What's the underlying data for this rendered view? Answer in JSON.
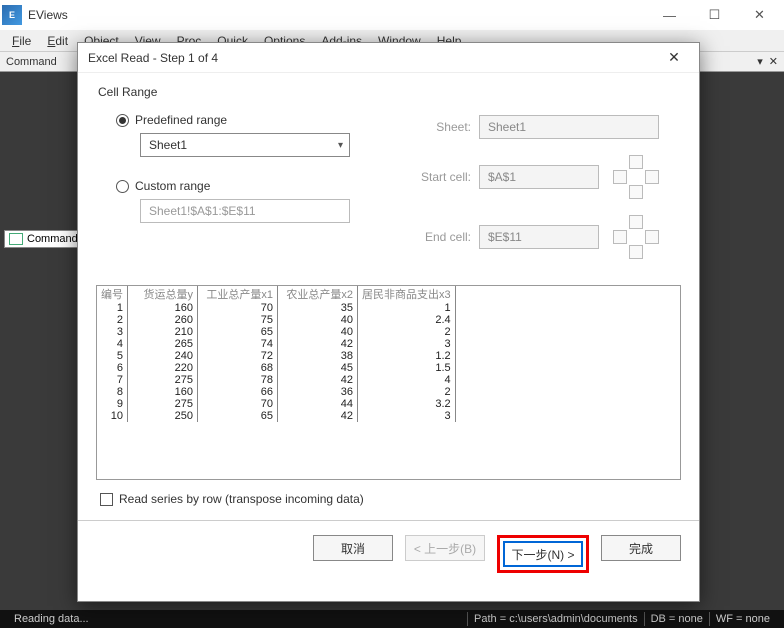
{
  "app": {
    "title": "EViews"
  },
  "menu": [
    "File",
    "Edit",
    "Object",
    "View",
    "Proc",
    "Quick",
    "Options",
    "Add-ins",
    "Window",
    "Help"
  ],
  "command_bar": {
    "label": "Command"
  },
  "command_panel": {
    "label": "Command"
  },
  "statusbar": {
    "left": "Reading data...",
    "path": "Path = c:\\users\\admin\\documents",
    "db": "DB = none",
    "wf": "WF = none"
  },
  "dialog": {
    "title": "Excel Read - Step 1 of 4",
    "group": "Cell Range",
    "predefined_label": "Predefined range",
    "predefined_value": "Sheet1",
    "custom_label": "Custom range",
    "custom_value": "Sheet1!$A$1:$E$11",
    "sheet_label": "Sheet:",
    "sheet_value": "Sheet1",
    "start_label": "Start cell:",
    "start_value": "$A$1",
    "end_label": "End cell:",
    "end_value": "$E$11",
    "checkbox_label": "Read series by row (transpose incoming data)",
    "buttons": {
      "cancel": "取消",
      "back": "< 上一步(B)",
      "next": "下一步(N) >",
      "finish": "完成"
    },
    "preview": {
      "headers": [
        "编号",
        "货运总量y",
        "工业总产量x1",
        "农业总产量x2",
        "居民非商品支出x3"
      ],
      "rows": [
        [
          1,
          160,
          70,
          35,
          1
        ],
        [
          2,
          260,
          75,
          40,
          2.4
        ],
        [
          3,
          210,
          65,
          40,
          2
        ],
        [
          4,
          265,
          74,
          42,
          3
        ],
        [
          5,
          240,
          72,
          38,
          1.2
        ],
        [
          6,
          220,
          68,
          45,
          1.5
        ],
        [
          7,
          275,
          78,
          42,
          4
        ],
        [
          8,
          160,
          66,
          36,
          2
        ],
        [
          9,
          275,
          70,
          44,
          3.2
        ],
        [
          10,
          250,
          65,
          42,
          3
        ]
      ]
    }
  }
}
